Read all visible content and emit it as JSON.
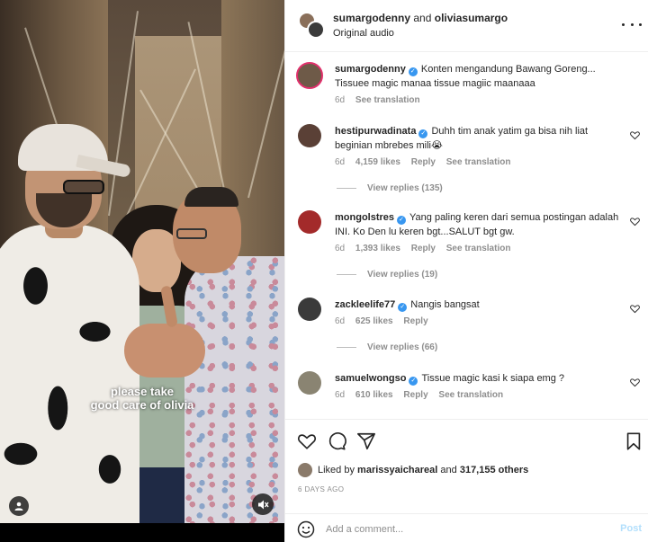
{
  "media": {
    "caption_line1": "please take",
    "caption_line2": "good care of olivia"
  },
  "header": {
    "user1": "sumargodenny",
    "joiner": "and",
    "user2": "oliviasumargo",
    "audio": "Original audio"
  },
  "caption_post": {
    "user": "sumargodenny",
    "text": "Konten mengandung Bawang Goreng... Tissuee magic manaa tissue magiic maanaaa",
    "time": "6d",
    "see_translation": "See translation"
  },
  "comments": [
    {
      "user": "hestipurwadinata",
      "text": "Duhh tim anak yatim ga bisa nih liat beginian mbrebes mili😭",
      "time": "6d",
      "likes": "4,159 likes",
      "reply": "Reply",
      "see_translation": "See translation",
      "view_replies": "View replies (135)"
    },
    {
      "user": "mongolstres",
      "text": "Yang paling keren dari semua postingan adalah INI. Ko Den lu keren bgt...SALUT bgt gw.",
      "time": "6d",
      "likes": "1,393 likes",
      "reply": "Reply",
      "see_translation": "See translation",
      "view_replies": "View replies (19)"
    },
    {
      "user": "zackleelife77",
      "text": "Nangis bangsat",
      "time": "6d",
      "likes": "625 likes",
      "reply": "Reply",
      "view_replies": "View replies (66)"
    },
    {
      "user": "samuelwongso",
      "text": "Tissue magic kasi k siapa emg ?",
      "time": "6d",
      "likes": "610 likes",
      "reply": "Reply",
      "see_translation": "See translation"
    }
  ],
  "likes": {
    "prefix": "Liked by",
    "user": "marissyaichareal",
    "joiner": "and",
    "others": "317,155 others"
  },
  "date": "6 DAYS AGO",
  "add_comment": {
    "placeholder": "Add a comment...",
    "post_label": "Post"
  },
  "colors": {
    "verified": "#3897f0",
    "muted_text": "#8e8e8e",
    "post_button": "#b2dffc"
  }
}
